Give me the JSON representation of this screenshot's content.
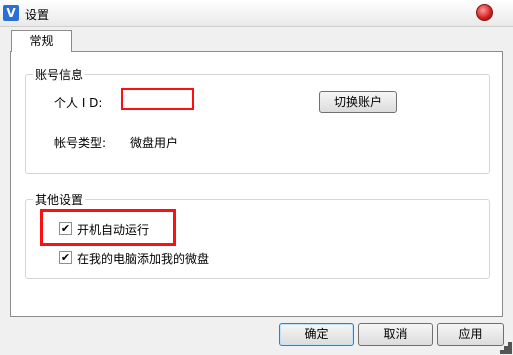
{
  "window": {
    "title": "设置",
    "app_icon_glyph": "V"
  },
  "tabs": [
    {
      "label": "常规"
    }
  ],
  "account": {
    "group_title": "账号信息",
    "id_label": "个人 I D:",
    "id_value": "",
    "switch_button": "切换账户",
    "type_label": "帐号类型:",
    "type_value": "微盘用户"
  },
  "other": {
    "group_title": "其他设置",
    "autostart_label": "开机自动运行",
    "autostart_checked": true,
    "add_to_computer_label": "在我的电脑添加我的微盘",
    "add_to_computer_checked": true
  },
  "footer": {
    "ok": "确定",
    "cancel": "取消",
    "apply": "应用"
  },
  "colors": {
    "highlight": "#ff1010",
    "close_button": "#d21d1d",
    "app_icon": "#2a6fd6"
  }
}
